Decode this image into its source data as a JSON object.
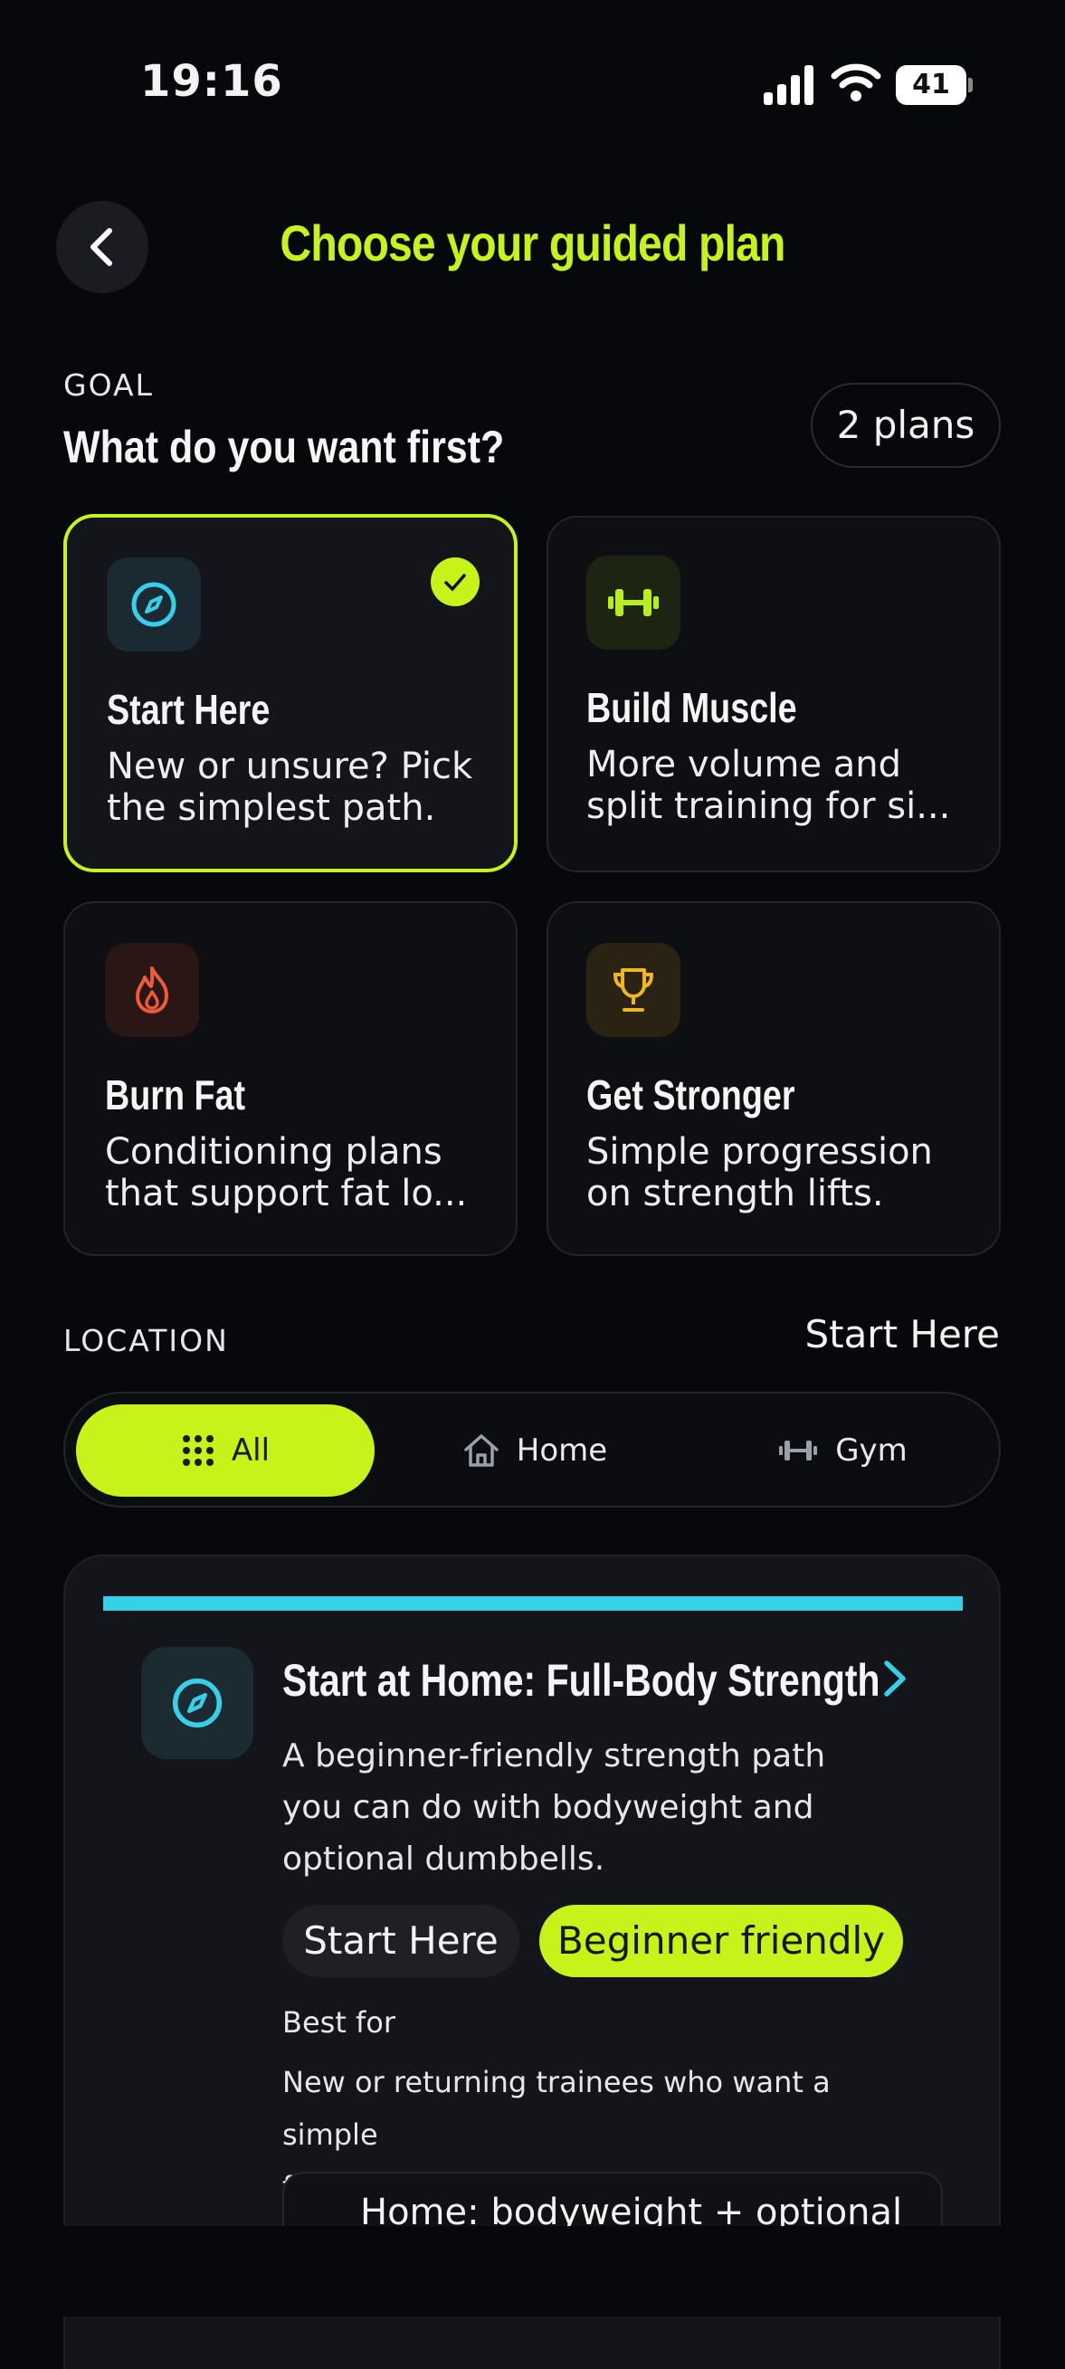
{
  "status_bar": {
    "time": "19:16",
    "battery": "41"
  },
  "header": {
    "title": "Choose your guided plan"
  },
  "goal": {
    "section_label": "GOAL",
    "question": "What do you want first?",
    "plans_count": "2 plans",
    "cards": [
      {
        "title": "Start Here",
        "desc_line1": "New or unsure? Pick",
        "desc_line2": "the simplest path.",
        "icon": "compass-icon",
        "color": "#36d0e8",
        "selected": true
      },
      {
        "title": "Build Muscle",
        "desc_line1": "More volume and",
        "desc_line2": "split training for si...",
        "icon": "dumbbell-icon",
        "color": "#b6ef1a",
        "selected": false
      },
      {
        "title": "Burn Fat",
        "desc_line1": "Conditioning plans",
        "desc_line2": "that support fat lo...",
        "icon": "flame-icon",
        "color": "#ee5a3c",
        "selected": false
      },
      {
        "title": "Get Stronger",
        "desc_line1": "Simple progression",
        "desc_line2": "on strength lifts.",
        "icon": "trophy-icon",
        "color": "#f2b51c",
        "selected": false
      }
    ]
  },
  "location": {
    "section_label": "LOCATION",
    "active_goal": "Start Here",
    "tabs": [
      {
        "label": "All",
        "icon": "grid-icon",
        "active": true
      },
      {
        "label": "Home",
        "icon": "home-icon",
        "active": false
      },
      {
        "label": "Gym",
        "icon": "dumbbell-icon",
        "active": false
      }
    ]
  },
  "plan": {
    "title": "Start at Home: Full-Body Strength",
    "desc_line1": "A beginner-friendly strength path",
    "desc_line2": "you can do with bodyweight and",
    "desc_line3": "optional dumbbells.",
    "tags": [
      "Start Here",
      "Beginner friendly"
    ],
    "best_for_label": "Best for",
    "best_for_line1": "New or returning trainees who want a simple",
    "best_for_line2": "first plan at home.",
    "equipment": "Home: bodyweight + optional",
    "accent_color": "#36d0e8"
  },
  "theme": {
    "accent": "#c6f31a",
    "background": "#07080b"
  }
}
